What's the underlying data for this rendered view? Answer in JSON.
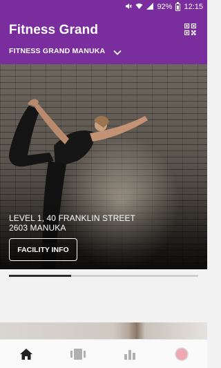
{
  "status_bar": {
    "battery": "92%",
    "time": "12:15",
    "icons": [
      "mute-icon",
      "wifi-icon",
      "signal-icon",
      "battery-icon"
    ]
  },
  "header": {
    "title": "Fitness Grand",
    "club": "FITNESS GRAND MANUKA",
    "qr_icon": "qr-code-icon",
    "chevron_icon": "chevron-down-icon"
  },
  "hero": {
    "address_line1": "LEVEL 1, 40 FRANKLIN STREET",
    "address_line2": "2603 MANUKA",
    "facility_button": "FACILITY INFO"
  },
  "pager": {
    "active_fraction": 0.33
  },
  "bottom_nav": {
    "items": [
      {
        "name": "home",
        "icon": "home-icon",
        "active": true
      },
      {
        "name": "classes",
        "icon": "cards-icon",
        "active": false
      },
      {
        "name": "stats",
        "icon": "bar-chart-icon",
        "active": false
      },
      {
        "name": "profile",
        "icon": "profile-circle-icon",
        "active": false
      }
    ]
  },
  "colors": {
    "brand": "#7a2d9c",
    "nav_active": "#222222",
    "nav_inactive": "#b0b0b0",
    "profile_accent": "#f0a8b2"
  }
}
